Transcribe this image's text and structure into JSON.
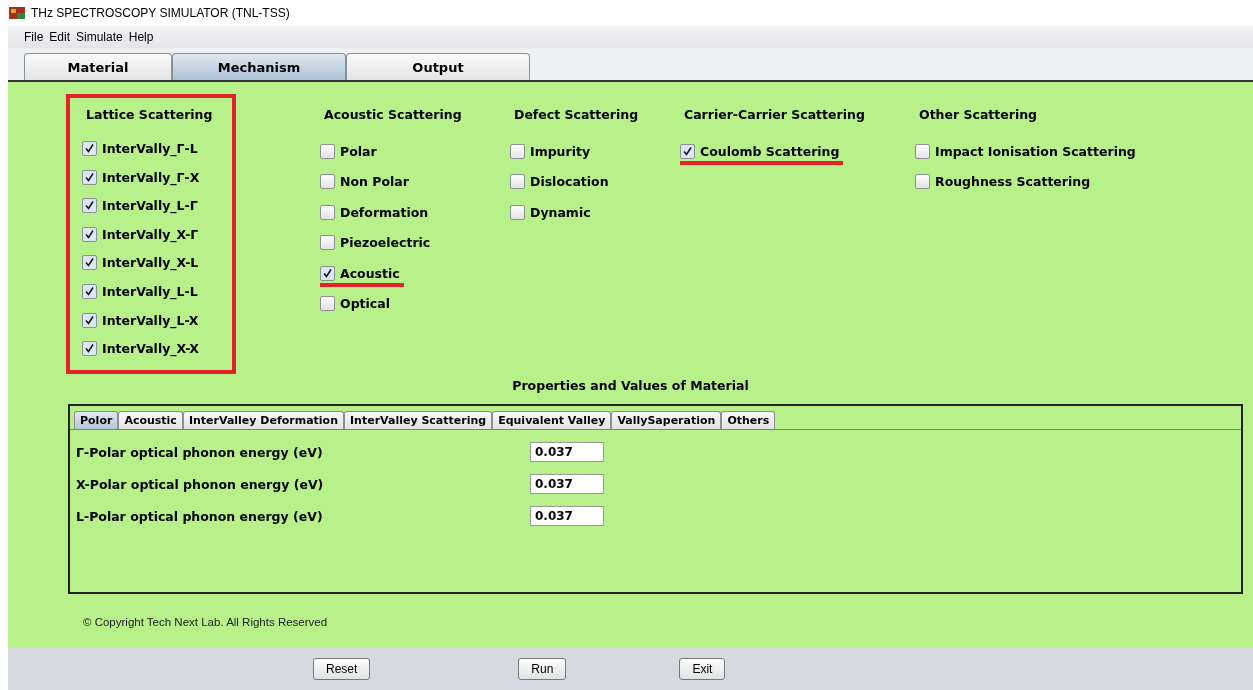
{
  "window": {
    "title": "THz SPECTROSCOPY SIMULATOR (TNL-TSS)"
  },
  "menu": [
    "File",
    "Edit",
    "Simulate",
    "Help"
  ],
  "tabs": [
    {
      "label": "Material",
      "selected": false
    },
    {
      "label": "Mechanism",
      "selected": true
    },
    {
      "label": "Output",
      "selected": false
    }
  ],
  "groups": [
    {
      "title": "Lattice Scattering",
      "highlighted": true,
      "items": [
        {
          "label": "InterVally_Γ-L",
          "checked": true,
          "underlined": false
        },
        {
          "label": "InterVally_Γ-X",
          "checked": true,
          "underlined": false
        },
        {
          "label": "InterVally_L-Γ",
          "checked": true,
          "underlined": false
        },
        {
          "label": "InterVally_X-Γ",
          "checked": true,
          "underlined": false
        },
        {
          "label": "InterVally_X-L",
          "checked": true,
          "underlined": false
        },
        {
          "label": "InterVally_L-L",
          "checked": true,
          "underlined": false
        },
        {
          "label": "InterVally_L-X",
          "checked": true,
          "underlined": false
        },
        {
          "label": "InterVally_X-X",
          "checked": true,
          "underlined": false
        }
      ]
    },
    {
      "title": "Acoustic Scattering",
      "highlighted": false,
      "items": [
        {
          "label": "Polar",
          "checked": false,
          "underlined": false
        },
        {
          "label": "Non Polar",
          "checked": false,
          "underlined": false
        },
        {
          "label": "Deformation",
          "checked": false,
          "underlined": false
        },
        {
          "label": "Piezoelectric",
          "checked": false,
          "underlined": false
        },
        {
          "label": "Acoustic",
          "checked": true,
          "underlined": true
        },
        {
          "label": "Optical",
          "checked": false,
          "underlined": false
        }
      ]
    },
    {
      "title": "Defect Scattering",
      "highlighted": false,
      "items": [
        {
          "label": "Impurity",
          "checked": false,
          "underlined": false
        },
        {
          "label": "Dislocation",
          "checked": false,
          "underlined": false
        },
        {
          "label": "Dynamic",
          "checked": false,
          "underlined": false
        }
      ]
    },
    {
      "title": "Carrier-Carrier Scattering",
      "highlighted": false,
      "items": [
        {
          "label": "Coulomb Scattering",
          "checked": true,
          "underlined": true
        }
      ]
    },
    {
      "title": "Other Scattering",
      "highlighted": false,
      "items": [
        {
          "label": "Impact Ionisation Scattering",
          "checked": false,
          "underlined": false
        },
        {
          "label": "Roughness Scattering",
          "checked": false,
          "underlined": false
        }
      ]
    }
  ],
  "properties": {
    "title": "Properties and Values of Material",
    "tabs": [
      {
        "label": "Polor",
        "selected": true
      },
      {
        "label": "Acoustic",
        "selected": false
      },
      {
        "label": "InterValley Deformation",
        "selected": false
      },
      {
        "label": "InterValley Scattering",
        "selected": false
      },
      {
        "label": "Equivalent Valley",
        "selected": false
      },
      {
        "label": "VallySaperation",
        "selected": false
      },
      {
        "label": "Others",
        "selected": false
      }
    ],
    "fields": [
      {
        "label": "Γ-Polar optical phonon energy (eV)",
        "value": "0.037"
      },
      {
        "label": "X-Polar optical phonon energy (eV)",
        "value": "0.037"
      },
      {
        "label": "L-Polar optical phonon energy (eV)",
        "value": "0.037"
      }
    ]
  },
  "copyright": "© Copyright Tech Next Lab. All Rights Reserved",
  "buttons": [
    "Reset",
    "Run",
    "Exit"
  ]
}
